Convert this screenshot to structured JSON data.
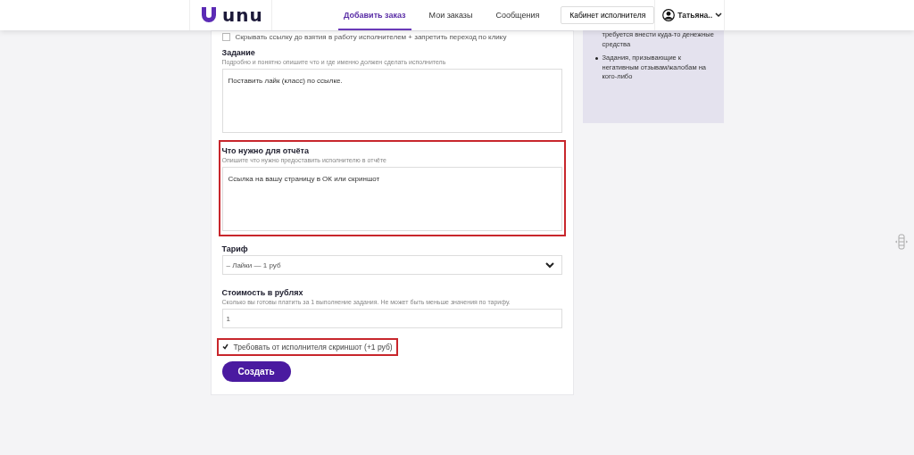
{
  "header": {
    "logo": "unu",
    "nav": [
      {
        "label": "Добавить заказ",
        "selected": true
      },
      {
        "label": "Мои заказы",
        "selected": false
      },
      {
        "label": "Сообщения",
        "selected": false
      }
    ],
    "cabinet_button": "Кабинет исполнителя",
    "user": "Татьяна.."
  },
  "form": {
    "top_option": {
      "label": "Скрывать ссылку до взятия в работу исполнителем + запретить переход по клику",
      "checked": false
    },
    "fields": [
      {
        "kind": "textarea",
        "label": "Задание",
        "hint": "Подробно и понятно опишите что и где именно должен сделать исполнитель",
        "value": "Поставить лайк (класс) по ссылке.",
        "highlighted": false
      },
      {
        "kind": "textarea",
        "label": "Что нужно для отчёта",
        "hint": "Опишите что нужно предоставить исполнителю в отчёте",
        "value": "Ссылка на вашу страницу в ОК или скриншот",
        "highlighted": true
      },
      {
        "kind": "select",
        "label": "Тариф",
        "value": "– Лайки — 1 руб",
        "highlighted": false
      },
      {
        "kind": "input",
        "label": "Стоимость в рублях",
        "hint": "Сколько вы готовы платить за 1 выполнение задания. Не может быть меньше значения по тарифу.",
        "value": "1",
        "highlighted": false
      }
    ],
    "screenshot_option": {
      "label": "Требовать от исполнителя скриншот (+1 руб)",
      "checked": true,
      "highlighted": true
    },
    "submit": "Создать"
  },
  "sidebar": {
    "items": [
      {
        "text": "требуется внести куда-то денежные средства",
        "bullet": false
      },
      {
        "text": "Задания, призывающие к негативным отзывам/жалобам на кого-либо",
        "bullet": true
      }
    ]
  }
}
